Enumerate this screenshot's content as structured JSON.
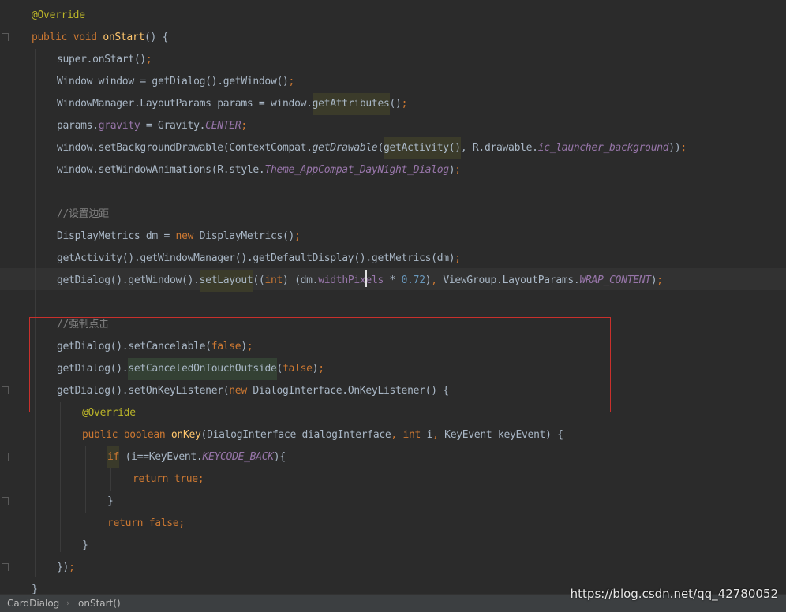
{
  "editor": {
    "lines": [
      [
        [
          "@Override",
          "an"
        ]
      ],
      [
        [
          "public ",
          "k"
        ],
        [
          "void ",
          "k"
        ],
        [
          "onStart",
          "fn"
        ],
        [
          "() {",
          ""
        ]
      ],
      [
        [
          "super",
          ""
        ],
        [
          ".onStart()",
          ""
        ],
        [
          ";",
          "k"
        ]
      ],
      [
        [
          "Window window = getDialog().getWindow()",
          ""
        ],
        [
          ";",
          "k"
        ]
      ],
      [
        [
          "WindowManager.LayoutParams params = window.",
          ""
        ],
        [
          "getAttributes",
          "hl-y"
        ],
        [
          "()",
          ""
        ],
        [
          ";",
          "k"
        ]
      ],
      [
        [
          "params.",
          ""
        ],
        [
          "gravity",
          "fd"
        ],
        [
          " = Gravity.",
          ""
        ],
        [
          "CENTER",
          "sf"
        ],
        [
          ";",
          "k"
        ]
      ],
      [
        [
          "window.setBackgroundDrawable(ContextCompat.",
          ""
        ],
        [
          "getDrawable",
          "it"
        ],
        [
          "(",
          ""
        ],
        [
          "getActivity()",
          "hl-y"
        ],
        [
          ", R.drawable.",
          ""
        ],
        [
          "ic_launcher_background",
          "sf"
        ],
        [
          "))",
          ""
        ],
        [
          ";",
          "k"
        ]
      ],
      [
        [
          "window.setWindowAnimations(R.style.",
          ""
        ],
        [
          "Theme_AppCompat_DayNight_Dialog",
          "sf"
        ],
        [
          ")",
          ""
        ],
        [
          ";",
          "k"
        ]
      ],
      [],
      [
        [
          "//设置边距",
          "cm"
        ]
      ],
      [
        [
          "DisplayMetrics dm = ",
          ""
        ],
        [
          "new ",
          "k"
        ],
        [
          "DisplayMetrics()",
          ""
        ],
        [
          ";",
          "k"
        ]
      ],
      [
        [
          "getActivity().getWindowManager().getDefaultDisplay().getMetrics(dm)",
          ""
        ],
        [
          ";",
          "k"
        ]
      ],
      [
        [
          "getDialog().getWindow().",
          ""
        ],
        [
          "setLayout",
          "hl-y"
        ],
        [
          "((",
          ""
        ],
        [
          "int",
          "k"
        ],
        [
          ") (dm.",
          ""
        ],
        [
          "widthPixels",
          "fd"
        ],
        [
          " * ",
          ""
        ],
        [
          "0.72",
          "nm"
        ],
        [
          ")",
          ""
        ],
        [
          ", ",
          "k"
        ],
        [
          "ViewGroup.LayoutParams.",
          ""
        ],
        [
          "WRAP_CONTENT",
          "sf"
        ],
        [
          ")",
          ""
        ],
        [
          ";",
          "k"
        ]
      ],
      [],
      [
        [
          "//强制点击",
          "cm"
        ]
      ],
      [
        [
          "getDialog().setCancelable(",
          ""
        ],
        [
          "false",
          "k"
        ],
        [
          ")",
          ""
        ],
        [
          ";",
          "k"
        ]
      ],
      [
        [
          "getDialog().",
          ""
        ],
        [
          "setCanceledOnTouchOutside",
          "hl-g"
        ],
        [
          "(",
          ""
        ],
        [
          "false",
          "k"
        ],
        [
          ")",
          ""
        ],
        [
          ";",
          "k"
        ]
      ],
      [
        [
          "getDialog().setOnKeyListener(",
          ""
        ],
        [
          "new ",
          "k"
        ],
        [
          "DialogInterface.OnKeyListener() {",
          ""
        ]
      ],
      [
        [
          "@Override",
          "an"
        ]
      ],
      [
        [
          "public ",
          "k"
        ],
        [
          "boolean ",
          "k"
        ],
        [
          "onKey",
          "fn"
        ],
        [
          "(DialogInterface dialogInterface",
          ""
        ],
        [
          ", ",
          "k"
        ],
        [
          "int ",
          "k"
        ],
        [
          "i",
          ""
        ],
        [
          ", ",
          "k"
        ],
        [
          "KeyEvent keyEvent) {",
          ""
        ]
      ],
      [
        [
          "if",
          "k hl-dim"
        ],
        [
          " (i==KeyEvent.",
          ""
        ],
        [
          "KEYCODE_BACK",
          "sf"
        ],
        [
          "){",
          ""
        ]
      ],
      [
        [
          "return ",
          "k"
        ],
        [
          "true",
          "k"
        ],
        [
          ";",
          "k"
        ]
      ],
      [
        [
          "}",
          ""
        ]
      ],
      [
        [
          "return ",
          "k"
        ],
        [
          "false",
          "k"
        ],
        [
          ";",
          "k"
        ]
      ],
      [
        [
          "}",
          ""
        ]
      ],
      [
        [
          "})",
          ""
        ],
        [
          ";",
          "k"
        ]
      ],
      [
        [
          "}",
          ""
        ]
      ]
    ]
  },
  "statusbar": {
    "breadcrumb_class": "CardDialog",
    "breadcrumb_method": "onStart()"
  },
  "watermark": "https://blog.csdn.net/qq_42780052"
}
